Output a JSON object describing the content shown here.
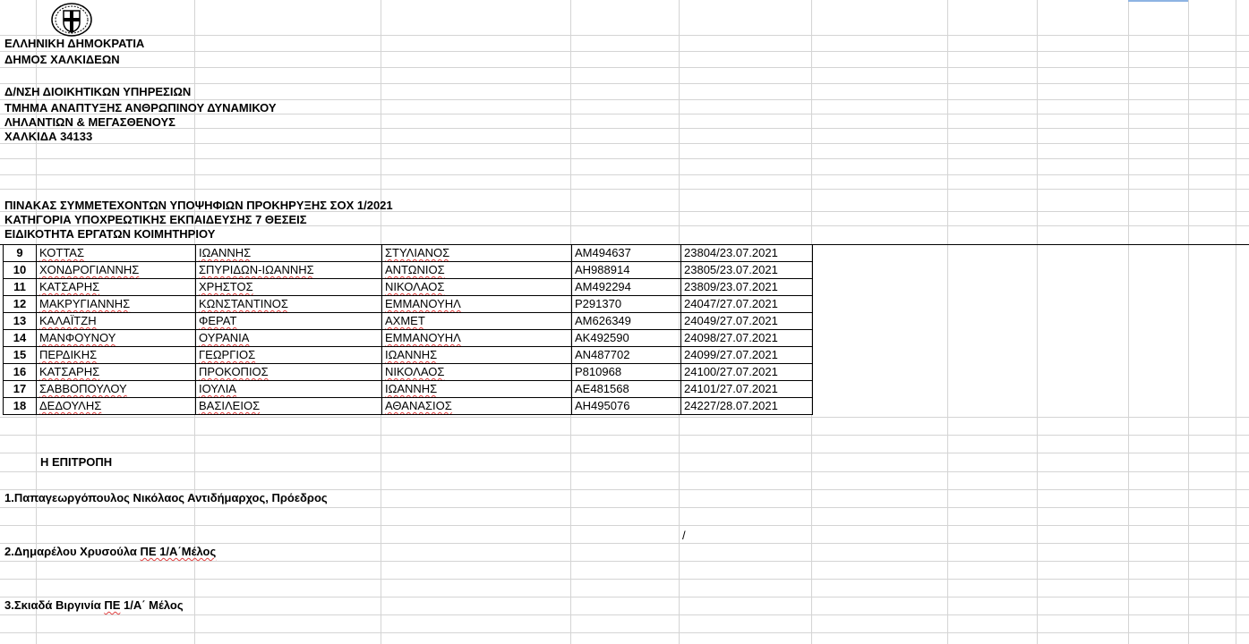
{
  "header": {
    "line1": "ΕΛΛΗΝΙΚΗ ΔΗΜΟΚΡΑΤΙΑ",
    "line2": "ΔΗΜΟΣ ΧΑΛΚΙΔΕΩΝ",
    "line3": "Δ/ΝΣΗ ΔΙΟΙΚΗΤΙΚΩΝ ΥΠΗΡΕΣΙΩΝ",
    "line4": "ΤΜΗΜΑ ΑΝΑΠΤΥΞΗΣ ΑΝΘΡΩΠΙΝΟΥ ΔΥΝΑΜΙΚΟΥ",
    "line5": "ΛΗΛΑΝΤΙΩΝ & ΜΕΓΑΣΘΕΝΟΥΣ",
    "line6": "ΧΑΛΚΙΔΑ 34133"
  },
  "titles": {
    "line1": "ΠΙΝΑΚΑΣ ΣΥΜΜΕΤΕΧΟΝΤΩΝ  ΥΠΟΨΗΦΙΩΝ  ΠΡΟΚΗΡΥΞΗΣ ΣΟΧ 1/2021",
    "line2": "ΚΑΤΗΓΟΡΙΑ ΥΠΟΧΡΕΩΤΙΚΗΣ ΕΚΠΑΙΔΕΥΣΗΣ  7 ΘΕΣΕΙΣ",
    "line3": "ΕΙΔΙΚΟΤΗΤΑ ΕΡΓΑΤΩΝ ΚΟΙΜΗΤΗΡΙΟΥ"
  },
  "rows": [
    {
      "num": "9",
      "surname": "ΚΟΤΤΑΣ",
      "name": "ΙΩΑΝΝΗΣ",
      "father": "ΣΤΥΛΙΑΝΟΣ",
      "id": "ΑΜ494637",
      "protocol": "23804/23.07.2021"
    },
    {
      "num": "10",
      "surname": "ΧΟΝΔΡΟΓΙΑΝΝΗΣ",
      "name": "ΣΠΥΡΙΔΩΝ-ΙΩΑΝΝΗΣ",
      "father": "ΑΝΤΩΝΙΟΣ",
      "id": "ΑΗ988914",
      "protocol": "23805/23.07.2021"
    },
    {
      "num": "11",
      "surname": "ΚΑΤΣΑΡΗΣ",
      "name": "ΧΡΗΣΤΟΣ",
      "father": "ΝΙΚΟΛΑΟΣ",
      "id": "ΑΜ492294",
      "protocol": "23809/23.07.2021"
    },
    {
      "num": "12",
      "surname": "ΜΑΚΡΥΓΙΑΝΝΗΣ",
      "name": "ΚΩΝΣΤΑΝΤΙΝΟΣ",
      "father": "ΕΜΜΑΝΟΥΗΛ",
      "id": "Ρ291370",
      "protocol": "24047/27.07.2021"
    },
    {
      "num": "13",
      "surname": "ΚΑΛΑΪΤΖΗ",
      "name": "ΦΕΡΑΤ",
      "father": "ΑΧΜΕΤ",
      "id": "ΑΜ626349",
      "protocol": "24049/27.07.2021"
    },
    {
      "num": "14",
      "surname": "ΜΑΝΦΟΥΝΟΥ",
      "name": "ΟΥΡΑΝΙΑ",
      "father": "ΕΜΜΑΝΟΥΗΛ",
      "id": "ΑΚ492590",
      "protocol": "24098/27.07.2021"
    },
    {
      "num": "15",
      "surname": "ΠΕΡΔΙΚΗΣ",
      "name": "ΓΕΩΡΓΙΟΣ",
      "father": "ΙΩΑΝΝΗΣ",
      "id": "ΑΝ487702",
      "protocol": "24099/27.07.2021"
    },
    {
      "num": "16",
      "surname": "ΚΑΤΣΑΡΗΣ",
      "name": "ΠΡΟΚΟΠΙΟΣ",
      "father": "ΝΙΚΟΛΑΟΣ",
      "id": "Ρ810968",
      "protocol": "24100/27.07.2021"
    },
    {
      "num": "17",
      "surname": "ΣΑΒΒΟΠΟΥΛΟΥ",
      "name": "ΙΟΥΛΙΑ",
      "father": "ΙΩΑΝΝΗΣ",
      "id": "ΑΕ481568",
      "protocol": "24101/27.07.2021"
    },
    {
      "num": "18",
      "surname": "ΔΕΔΟΥΛΗΣ",
      "name": "ΒΑΣΙΛΕΙΟΣ",
      "father": "ΑΘΑΝΑΣΙΟΣ",
      "id": "ΑΗ495076",
      "protocol": "24227/28.07.2021"
    }
  ],
  "committee": {
    "heading": "Η ΕΠΙΤΡΟΠΗ",
    "member1": "1.Παπαγεωργόπουλος Νικόλαος Αντιδήμαρχος, Πρόεδρος",
    "member2_prefix": "2.Δημαρέλου Χρυσούλα ",
    "member2_suffix": "ΠΕ 1/Α΄Μέλος",
    "member3_prefix": "3.Σκιαδά Βιργινία  ",
    "member3_suffix": "ΠΕ",
    "member3_rest": " 1/Α΄  Μέλος"
  },
  "stray_mark": "/",
  "icons": {
    "emblem": "greek-coat-of-arms-icon"
  }
}
